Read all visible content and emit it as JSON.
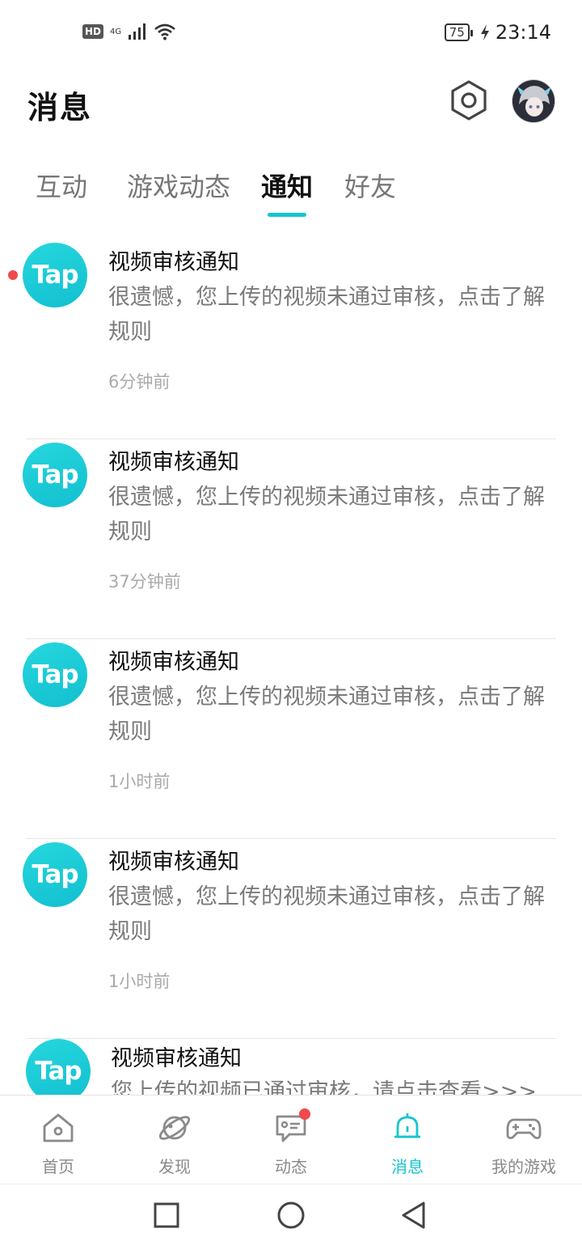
{
  "status_bar": {
    "hd": "HD",
    "network": "4G",
    "battery": "75",
    "time": "23:14"
  },
  "header": {
    "title": "消息",
    "settings_icon": "settings-hex-icon",
    "avatar_icon": "user-avatar"
  },
  "tabs": [
    {
      "label": "互动"
    },
    {
      "label": "游戏动态"
    },
    {
      "label": "通知"
    },
    {
      "label": "好友"
    }
  ],
  "active_tab": "通知",
  "notifications": [
    {
      "sender_logo": "Tap",
      "title": "视频审核通知",
      "body": "很遗憾，您上传的视频未通过审核，点击了解规则",
      "time": "6分钟前",
      "unread": true
    },
    {
      "sender_logo": "Tap",
      "title": "视频审核通知",
      "body": "很遗憾，您上传的视频未通过审核，点击了解规则",
      "time": "37分钟前",
      "unread": false
    },
    {
      "sender_logo": "Tap",
      "title": "视频审核通知",
      "body": "很遗憾，您上传的视频未通过审核，点击了解规则",
      "time": "1小时前",
      "unread": false
    },
    {
      "sender_logo": "Tap",
      "title": "视频审核通知",
      "body": "很遗憾，您上传的视频未通过审核，点击了解规则",
      "time": "1小时前",
      "unread": false
    },
    {
      "sender_logo": "Tap",
      "title": "视频审核通知",
      "body": "您上传的视频已通过审核，请点击查看>>>",
      "time": "",
      "unread": false
    }
  ],
  "bottom_nav": [
    {
      "label": "首页",
      "icon": "home-icon"
    },
    {
      "label": "发现",
      "icon": "planet-icon"
    },
    {
      "label": "动态",
      "icon": "feed-icon",
      "badge": true
    },
    {
      "label": "消息",
      "icon": "bell-icon",
      "active": true
    },
    {
      "label": "我的游戏",
      "icon": "gamepad-icon"
    }
  ],
  "colors": {
    "accent": "#15c5ce",
    "badge": "#f04a4a",
    "tap_logo_start": "#25d7dd",
    "tap_logo_end": "#13bfd0"
  }
}
